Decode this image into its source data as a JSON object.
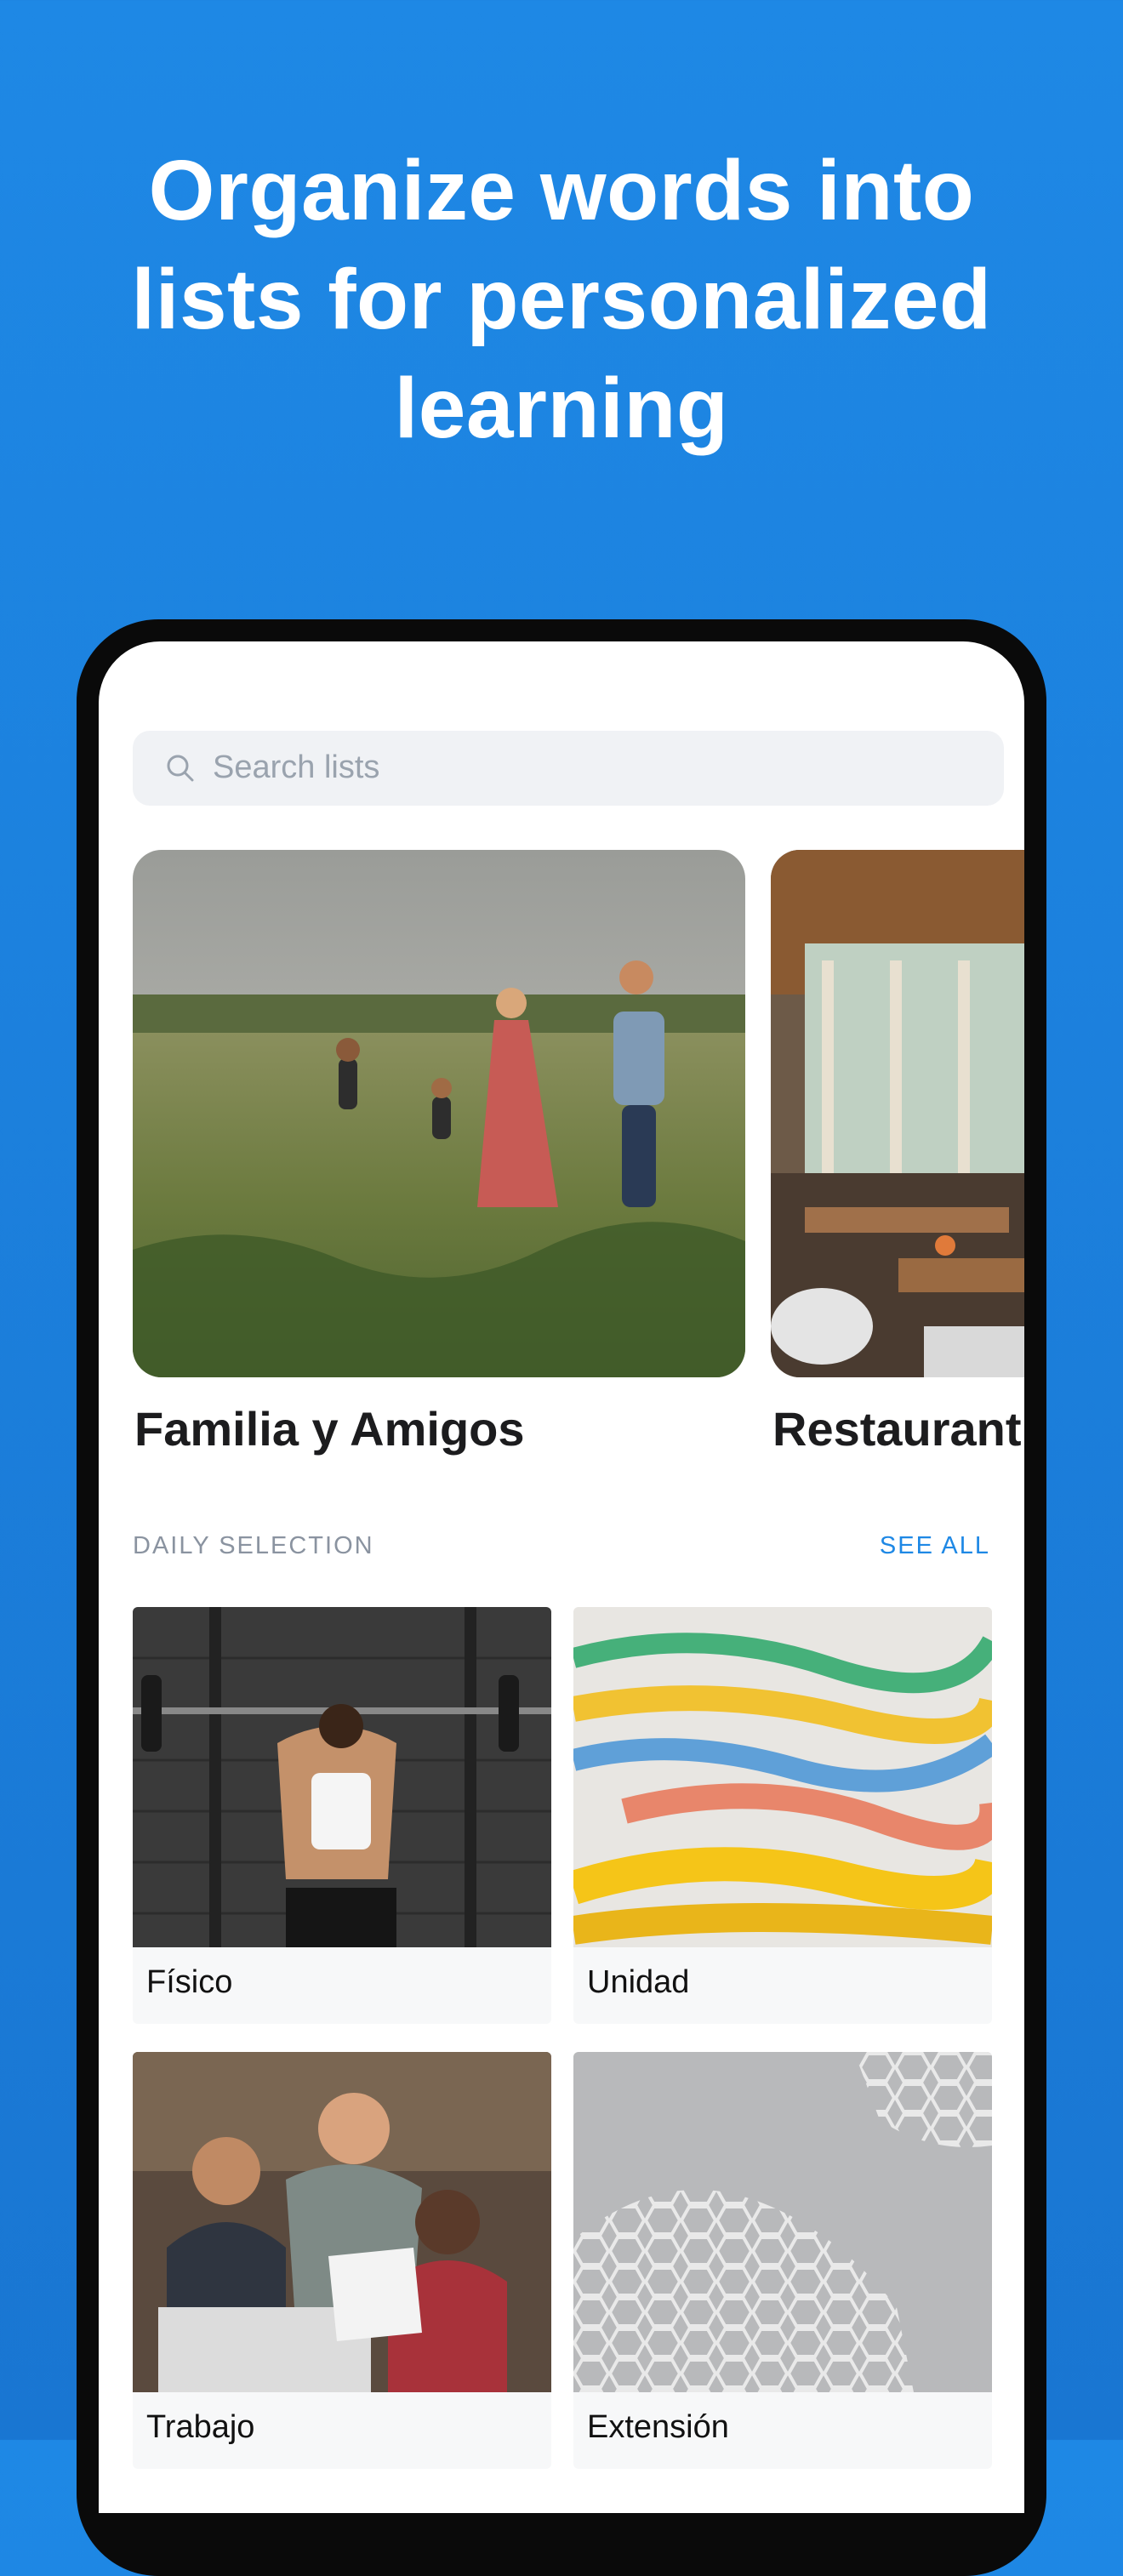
{
  "headline": {
    "line1": "Organize words into",
    "line2": "lists for personalized",
    "line3": "learning"
  },
  "search": {
    "placeholder": "Search lists",
    "icon": "search-icon"
  },
  "featured_lists": [
    {
      "title": "Familia y Amigos"
    },
    {
      "title": "Restaurant"
    }
  ],
  "daily_selection": {
    "label": "DAILY SELECTION",
    "see_all": "SEE ALL",
    "items": [
      {
        "label": "Físico"
      },
      {
        "label": "Unidad"
      },
      {
        "label": "Trabajo"
      },
      {
        "label": "Extensión"
      }
    ]
  },
  "colors": {
    "background": "#1E88E5",
    "accent": "#1E88E5",
    "search_bg": "#F0F2F5"
  }
}
